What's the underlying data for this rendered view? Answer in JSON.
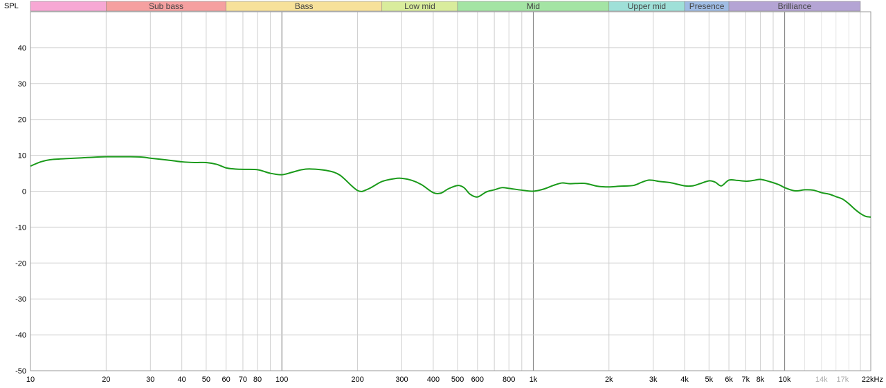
{
  "chart_data": {
    "type": "line",
    "ylabel": "SPL",
    "xscale": "log",
    "xlim": [
      10,
      22000
    ],
    "ylim": [
      -50,
      50
    ],
    "grid": true,
    "bands": [
      {
        "label": "",
        "from": 10,
        "to": 20,
        "color": "#f7a8d4"
      },
      {
        "label": "Sub bass",
        "from": 20,
        "to": 60,
        "color": "#f5a0a0"
      },
      {
        "label": "Bass",
        "from": 60,
        "to": 250,
        "color": "#f7e19a"
      },
      {
        "label": "Low mid",
        "from": 250,
        "to": 500,
        "color": "#d9ec9c"
      },
      {
        "label": "Mid",
        "from": 500,
        "to": 2000,
        "color": "#a4e4a4"
      },
      {
        "label": "Upper mid",
        "from": 2000,
        "to": 4000,
        "color": "#9fe0d8"
      },
      {
        "label": "Presence",
        "from": 4000,
        "to": 6000,
        "color": "#9fbce4"
      },
      {
        "label": "Brilliance",
        "from": 6000,
        "to": 20000,
        "color": "#b4a4d4"
      }
    ],
    "yticks": [
      {
        "value": 40,
        "label": "40"
      },
      {
        "value": 30,
        "label": "30"
      },
      {
        "value": 20,
        "label": "20"
      },
      {
        "value": 10,
        "label": "10"
      },
      {
        "value": 0,
        "label": "0"
      },
      {
        "value": -10,
        "label": "-10"
      },
      {
        "value": -20,
        "label": "-20"
      },
      {
        "value": -30,
        "label": "-30"
      },
      {
        "value": -40,
        "label": "-40"
      },
      {
        "value": -50,
        "label": "-50"
      }
    ],
    "xticks": [
      {
        "value": 10,
        "label": "10"
      },
      {
        "value": 20,
        "label": "20"
      },
      {
        "value": 30,
        "label": "30"
      },
      {
        "value": 40,
        "label": "40"
      },
      {
        "value": 50,
        "label": "50"
      },
      {
        "value": 60,
        "label": "60"
      },
      {
        "value": 70,
        "label": "70"
      },
      {
        "value": 80,
        "label": "80"
      },
      {
        "value": 100,
        "label": "100"
      },
      {
        "value": 200,
        "label": "200"
      },
      {
        "value": 300,
        "label": "300"
      },
      {
        "value": 400,
        "label": "400"
      },
      {
        "value": 500,
        "label": "500"
      },
      {
        "value": 600,
        "label": "600"
      },
      {
        "value": 800,
        "label": "800"
      },
      {
        "value": 1000,
        "label": "1k"
      },
      {
        "value": 2000,
        "label": "2k"
      },
      {
        "value": 3000,
        "label": "3k"
      },
      {
        "value": 4000,
        "label": "4k"
      },
      {
        "value": 5000,
        "label": "5k"
      },
      {
        "value": 6000,
        "label": "6k"
      },
      {
        "value": 7000,
        "label": "7k"
      },
      {
        "value": 8000,
        "label": "8k"
      },
      {
        "value": 10000,
        "label": "10k"
      },
      {
        "value": 14000,
        "label": "14k",
        "faint": true
      },
      {
        "value": 17000,
        "label": "17k",
        "faint": true
      },
      {
        "value": 22000,
        "label": "22kHz"
      }
    ],
    "series": [
      {
        "color": "#1a9a1a",
        "x": [
          10,
          11,
          12,
          14,
          16,
          18,
          20,
          22,
          25,
          28,
          30,
          35,
          40,
          45,
          50,
          55,
          60,
          65,
          70,
          80,
          90,
          100,
          110,
          120,
          130,
          150,
          170,
          200,
          220,
          250,
          280,
          300,
          330,
          360,
          400,
          430,
          460,
          500,
          530,
          560,
          600,
          650,
          700,
          750,
          800,
          900,
          1000,
          1100,
          1200,
          1300,
          1400,
          1600,
          1800,
          2000,
          2200,
          2500,
          2700,
          2900,
          3200,
          3500,
          4000,
          4300,
          4600,
          5000,
          5300,
          5600,
          6000,
          6500,
          7000,
          7500,
          8000,
          8700,
          9500,
          10000,
          11000,
          12000,
          13000,
          14000,
          15000,
          16000,
          17000,
          18000,
          19000,
          20000,
          21000,
          22000
        ],
        "y": [
          7,
          8.2,
          8.8,
          9.1,
          9.3,
          9.5,
          9.6,
          9.6,
          9.6,
          9.5,
          9.2,
          8.7,
          8.2,
          8.0,
          8.0,
          7.5,
          6.5,
          6.2,
          6.1,
          6.0,
          5.0,
          4.6,
          5.3,
          6.0,
          6.2,
          5.8,
          4.5,
          0.2,
          0.6,
          2.7,
          3.5,
          3.6,
          3.0,
          1.8,
          -0.4,
          -0.5,
          0.7,
          1.6,
          1.0,
          -0.8,
          -1.6,
          -0.2,
          0.4,
          1.0,
          0.8,
          0.3,
          0.0,
          0.6,
          1.6,
          2.3,
          2.1,
          2.2,
          1.4,
          1.2,
          1.4,
          1.6,
          2.5,
          3.1,
          2.7,
          2.4,
          1.5,
          1.5,
          2.1,
          2.9,
          2.5,
          1.5,
          3.1,
          3.0,
          2.8,
          3.0,
          3.3,
          2.7,
          1.8,
          1.0,
          0.1,
          0.4,
          0.3,
          -0.4,
          -0.8,
          -1.5,
          -2.2,
          -3.5,
          -5.0,
          -6.2,
          -7.0,
          -7.2
        ]
      }
    ]
  }
}
